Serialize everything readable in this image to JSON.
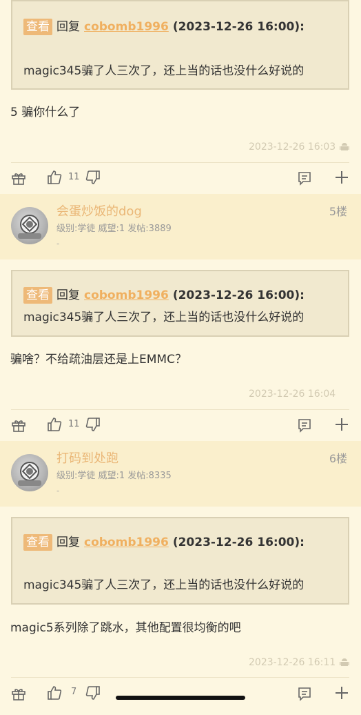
{
  "quote_tag": "查看",
  "reply_word": "回复",
  "posts": [
    {
      "quote": {
        "user": "cobomb1996",
        "time": "(2023-12-26 16:00):",
        "text": "magic345骗了人三次了，还上当的话也没什么好说的"
      },
      "body": "5 骗你什么了",
      "timestamp": "2023-12-26 16:03",
      "likes": "11",
      "android": true
    },
    {
      "author": {
        "name": "会蛋炒饭的dog",
        "meta": "级别:学徒   威望:1   发帖:3889",
        "floor": "5楼",
        "sub": "-"
      },
      "quote": {
        "user": "cobomb1996",
        "time": "(2023-12-26 16:00):",
        "text": "magic345骗了人三次了，还上当的话也没什么好说的"
      },
      "body": "骗啥？不给疏油层还是上EMMC？",
      "timestamp": "2023-12-26 16:04",
      "likes": "11",
      "android": false
    },
    {
      "author": {
        "name": "打码到处跑",
        "meta": "级别:学徒   威望:1   发帖:8335",
        "floor": "6楼",
        "sub": "-"
      },
      "quote": {
        "user": "cobomb1996",
        "time": "(2023-12-26 16:00):",
        "text": "magic345骗了人三次了，还上当的话也没什么好说的"
      },
      "body": "magic5系列除了跳水，其他配置很均衡的吧",
      "timestamp": "2023-12-26 16:11",
      "likes": "7",
      "android": true
    }
  ],
  "icons": {
    "gift": "gift-icon",
    "thumb_up": "thumb-up-icon",
    "thumb_down": "thumb-down-icon",
    "comment": "comment-icon",
    "plus": "plus-icon",
    "android": "android-icon",
    "avatar": "diver-helmet-avatar"
  },
  "colors": {
    "background": "#fdf7e1",
    "header_band": "#faefcc",
    "accent": "#eeb978",
    "username": "#eab777"
  }
}
